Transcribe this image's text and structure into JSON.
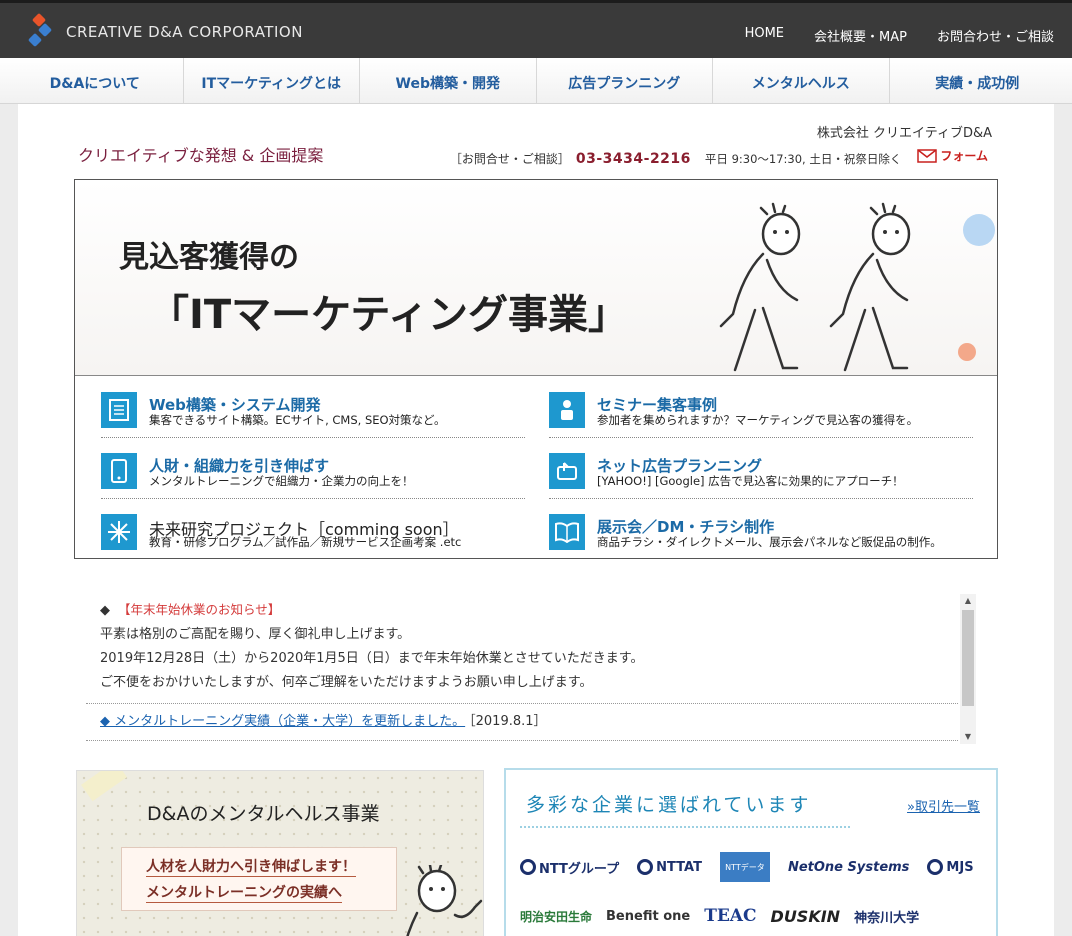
{
  "header": {
    "brand": "CREATIVE D&A CORPORATION",
    "topnav": [
      "HOME",
      "会社概要・MAP",
      "お問合わせ・ご相談"
    ]
  },
  "global_nav": [
    "D&Aについて",
    "ITマーケティングとは",
    "Web構築・開発",
    "広告プランニング",
    "メンタルヘルス",
    "実績・成功例"
  ],
  "intro": {
    "tagline": "クリエイティブな発想 & 企画提案",
    "company": "株式会社 クリエイティブD&A",
    "contact_label": "［お問合せ・ご相談］",
    "phone": "03-3434-2216",
    "hours": "平日 9:30〜17:30, 土日・祝祭日除く",
    "form_label": "フォーム"
  },
  "hero": {
    "line1": "見込客獲得の",
    "line2": "「ITマーケティング事業」"
  },
  "services": [
    {
      "title": "Web構築・システム開発",
      "desc": "集客できるサイト構築。ECサイト, CMS, SEO対策など。",
      "icon": "document-icon"
    },
    {
      "title": "セミナー集客事例",
      "desc": "参加者を集められますか？マーケティングで見込客の獲得を。",
      "icon": "person-icon"
    },
    {
      "title": "人財・組織力を引き伸ばす",
      "desc": "メンタルトレーニングで組織力・企業力の向上を！",
      "icon": "tablet-icon"
    },
    {
      "title": "ネット広告プランニング",
      "desc": "[YAHOO!] [Google] 広告で見込客に効果的にアプローチ！",
      "icon": "cursor-icon"
    },
    {
      "title": "未来研究プロジェクト［comming soon］",
      "desc": "教育・研修プログラム／試作品／新規サービス企画考案 .etc",
      "icon": "sparkle-icon"
    },
    {
      "title": "展示会／DM・チラシ制作",
      "desc": "商品チラシ・ダイレクトメール、展示会パネルなど販促品の制作。",
      "icon": "book-icon"
    }
  ],
  "news": {
    "bullet": "◆",
    "heading": "【年末年始休業のお知らせ】",
    "lines": [
      "平素は格別のご高配を賜り、厚く御礼申し上げます。",
      "2019年12月28日（土）から2020年1月5日（日）まで年末年始休業とさせていただきます。",
      "ご不便をおかけいたしますが、何卒ご理解をいただけますようお願い申し上げます。"
    ],
    "link_text": "◆ メンタルトレーニング実績（企業・大学）を更新しました。",
    "link_date": "［2019.8.1］"
  },
  "mental_card": {
    "title": "D&Aのメンタルヘルス事業",
    "line1": "人材を人財力へ引き伸ばします！",
    "line2": "メンタルトレーニングの実績へ"
  },
  "clients_card": {
    "title": "多彩な企業に選ばれています",
    "more": "»取引先一覧",
    "row1": [
      "NTTグループ",
      "NTTAT",
      "NTTデータ",
      "NetOne Systems",
      "MJS"
    ],
    "row2": [
      "明治安田生命",
      "Benefit one",
      "TEAC",
      "DUSKIN",
      "神奈川大学"
    ]
  },
  "colors": {
    "topbar": "#3a3a3a",
    "nav_text": "#235d9e",
    "service_title": "#1b6aa6",
    "icon_bg": "#1e98cf",
    "phone": "#8a1e2e",
    "alert": "#d43a3a"
  }
}
